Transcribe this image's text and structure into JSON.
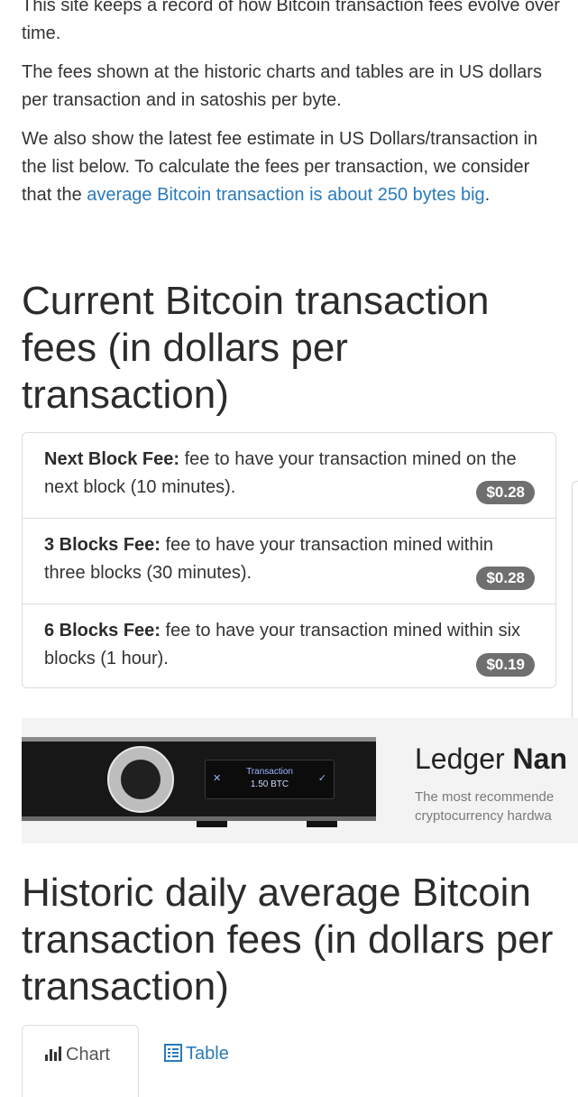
{
  "intro": {
    "p1": "This site keeps a record of how Bitcoin transaction fees evolve over time.",
    "p2": "The fees shown at the historic charts and tables are in US dollars per transaction and in satoshis per byte.",
    "p3_text": "We also show the latest fee estimate in US Dollars/transaction in the list below. To calculate the fees per transaction, we consider that the ",
    "p3_link": "average Bitcoin transaction is about 250 bytes big",
    "p3_end": "."
  },
  "current_title": "Current Bitcoin transaction fees (in dollars per transaction)",
  "fees": [
    {
      "name": "Next Block Fee:",
      "desc": " fee to have your transaction mined on the next block (10 minutes).",
      "value": "$0.28"
    },
    {
      "name": "3 Blocks Fee:",
      "desc": " fee to have your transaction mined within three blocks (30 minutes).",
      "value": "$0.28"
    },
    {
      "name": "6 Blocks Fee:",
      "desc": " fee to have your transaction mined within six blocks (1 hour).",
      "value": "$0.19"
    }
  ],
  "ad": {
    "screen_line1": "Transaction",
    "screen_line2": "1.50 BTC",
    "brand_regular": "Ledger ",
    "brand_bold": "Nan",
    "sub_line1": "The most recommende",
    "sub_line2": "cryptocurrency hardwa"
  },
  "historic_title": "Historic daily average Bitcoin transaction fees (in dollars per transaction)",
  "tabs": [
    {
      "label": "Chart",
      "icon": "bar-chart-icon",
      "active": true
    },
    {
      "label": "Table",
      "icon": "table-icon",
      "active": false
    }
  ],
  "colors": {
    "link": "#2a7ab8",
    "badge": "#6f6f6f",
    "border": "#dddddd"
  }
}
